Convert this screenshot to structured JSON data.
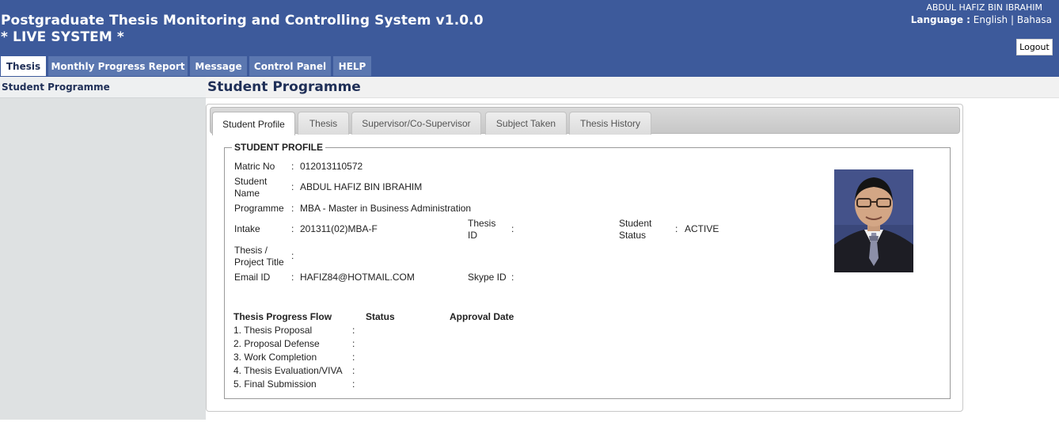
{
  "header": {
    "title_line1": "Postgraduate Thesis Monitoring and Controlling System v1.0.0",
    "title_line2": "* LIVE SYSTEM *",
    "user_name": "ABDUL HAFIZ BIN IBRAHIM",
    "language_label": "Language :",
    "lang_english": "English",
    "lang_separator": "|",
    "lang_bahasa": "Bahasa",
    "logout_label": "Logout"
  },
  "nav": {
    "tabs": [
      {
        "label": "Thesis",
        "active": true
      },
      {
        "label": "Monthly Progress Report",
        "active": false
      },
      {
        "label": "Message",
        "active": false
      },
      {
        "label": "Control Panel",
        "active": false
      },
      {
        "label": "HELP",
        "active": false
      }
    ]
  },
  "sidebar": {
    "items": [
      {
        "label": "Student Programme"
      }
    ]
  },
  "page": {
    "title": "Student Programme"
  },
  "panel_tabs": [
    {
      "label": "Student Profile",
      "active": true
    },
    {
      "label": "Thesis",
      "active": false
    },
    {
      "label": "Supervisor/Co-Supervisor",
      "active": false
    },
    {
      "label": "Subject Taken",
      "active": false
    },
    {
      "label": "Thesis History",
      "active": false
    }
  ],
  "profile": {
    "legend": "STUDENT PROFILE",
    "colon": ":",
    "matric_label": "Matric No",
    "matric_value": "012013110572",
    "name_label_1": "Student",
    "name_label_2": "Name",
    "name_value": "ABDUL HAFIZ BIN IBRAHIM",
    "programme_label": "Programme",
    "programme_value": "MBA - Master in Business Administration",
    "intake_label": "Intake",
    "intake_value": "201311(02)MBA-F",
    "thesis_id_label_1": "Thesis",
    "thesis_id_label_2": "ID",
    "thesis_id_value": "",
    "status_label_1": "Student",
    "status_label_2": "Status",
    "status_value": "ACTIVE",
    "title_label_1": "Thesis /",
    "title_label_2": "Project Title",
    "title_value": "",
    "email_label": "Email ID",
    "email_value": "HAFIZ84@HOTMAIL.COM",
    "skype_label": "Skype ID",
    "skype_value": ""
  },
  "progress": {
    "col_flow": "Thesis Progress Flow",
    "col_status": "Status",
    "col_date": "Approval Date",
    "rows": [
      {
        "label": "1. Thesis Proposal",
        "status": "",
        "date": ""
      },
      {
        "label": "2. Proposal Defense",
        "status": "",
        "date": ""
      },
      {
        "label": "3. Work Completion",
        "status": "",
        "date": ""
      },
      {
        "label": "4. Thesis Evaluation/VIVA",
        "status": "",
        "date": ""
      },
      {
        "label": "5. Final Submission",
        "status": "",
        "date": ""
      }
    ]
  },
  "colors": {
    "header_bg": "#3d5a9b",
    "nav_tab_bg": "#5b77b0",
    "sidebar_bg": "#dee1e2",
    "heading_text": "#1f2f57"
  }
}
